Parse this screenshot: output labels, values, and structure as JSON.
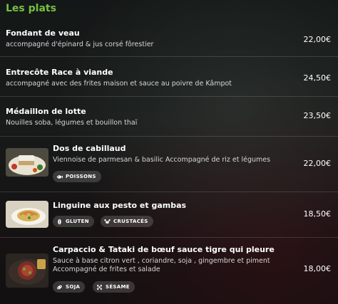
{
  "section": {
    "title": "Les plats"
  },
  "items": [
    {
      "name": "Fondant de veau",
      "desc": "accompagné d'épinard & jus corsé fôrestier",
      "price": "22,00€"
    },
    {
      "name": "Entrecôte Race à viande",
      "desc": "accompagné avec des frites maison et sauce au poivre de Kâmpot",
      "price": "24,50€"
    },
    {
      "name": "Médaillon de lotte",
      "desc": "Nouilles soba, légumes et bouillon thaï",
      "price": "23,50€"
    },
    {
      "name": "Dos de cabillaud",
      "desc": "Viennoise de parmesan & basilic Accompagné de riz et légumes",
      "price": "22,00€",
      "tags": [
        "POISSONS"
      ]
    },
    {
      "name": "Linguine aux pesto et gambas",
      "desc": "",
      "price": "18,50€",
      "tags": [
        "GLUTEN",
        "CRUSTACÉS"
      ]
    },
    {
      "name": "Carpaccio & Tataki de bœuf sauce tigre qui pleure",
      "desc_lines": [
        "Sauce à base citron vert , coriandre, soja , gingembre et piment",
        "Accompagné de frites et salade"
      ],
      "price": "18,00€",
      "tags": [
        "SOJA",
        "SÉSAME"
      ]
    }
  ],
  "icons": {
    "poissons": "fish-icon",
    "gluten": "wheat-icon",
    "crustaces": "crab-icon",
    "soja": "soy-icon",
    "sesame": "sesame-icon"
  }
}
